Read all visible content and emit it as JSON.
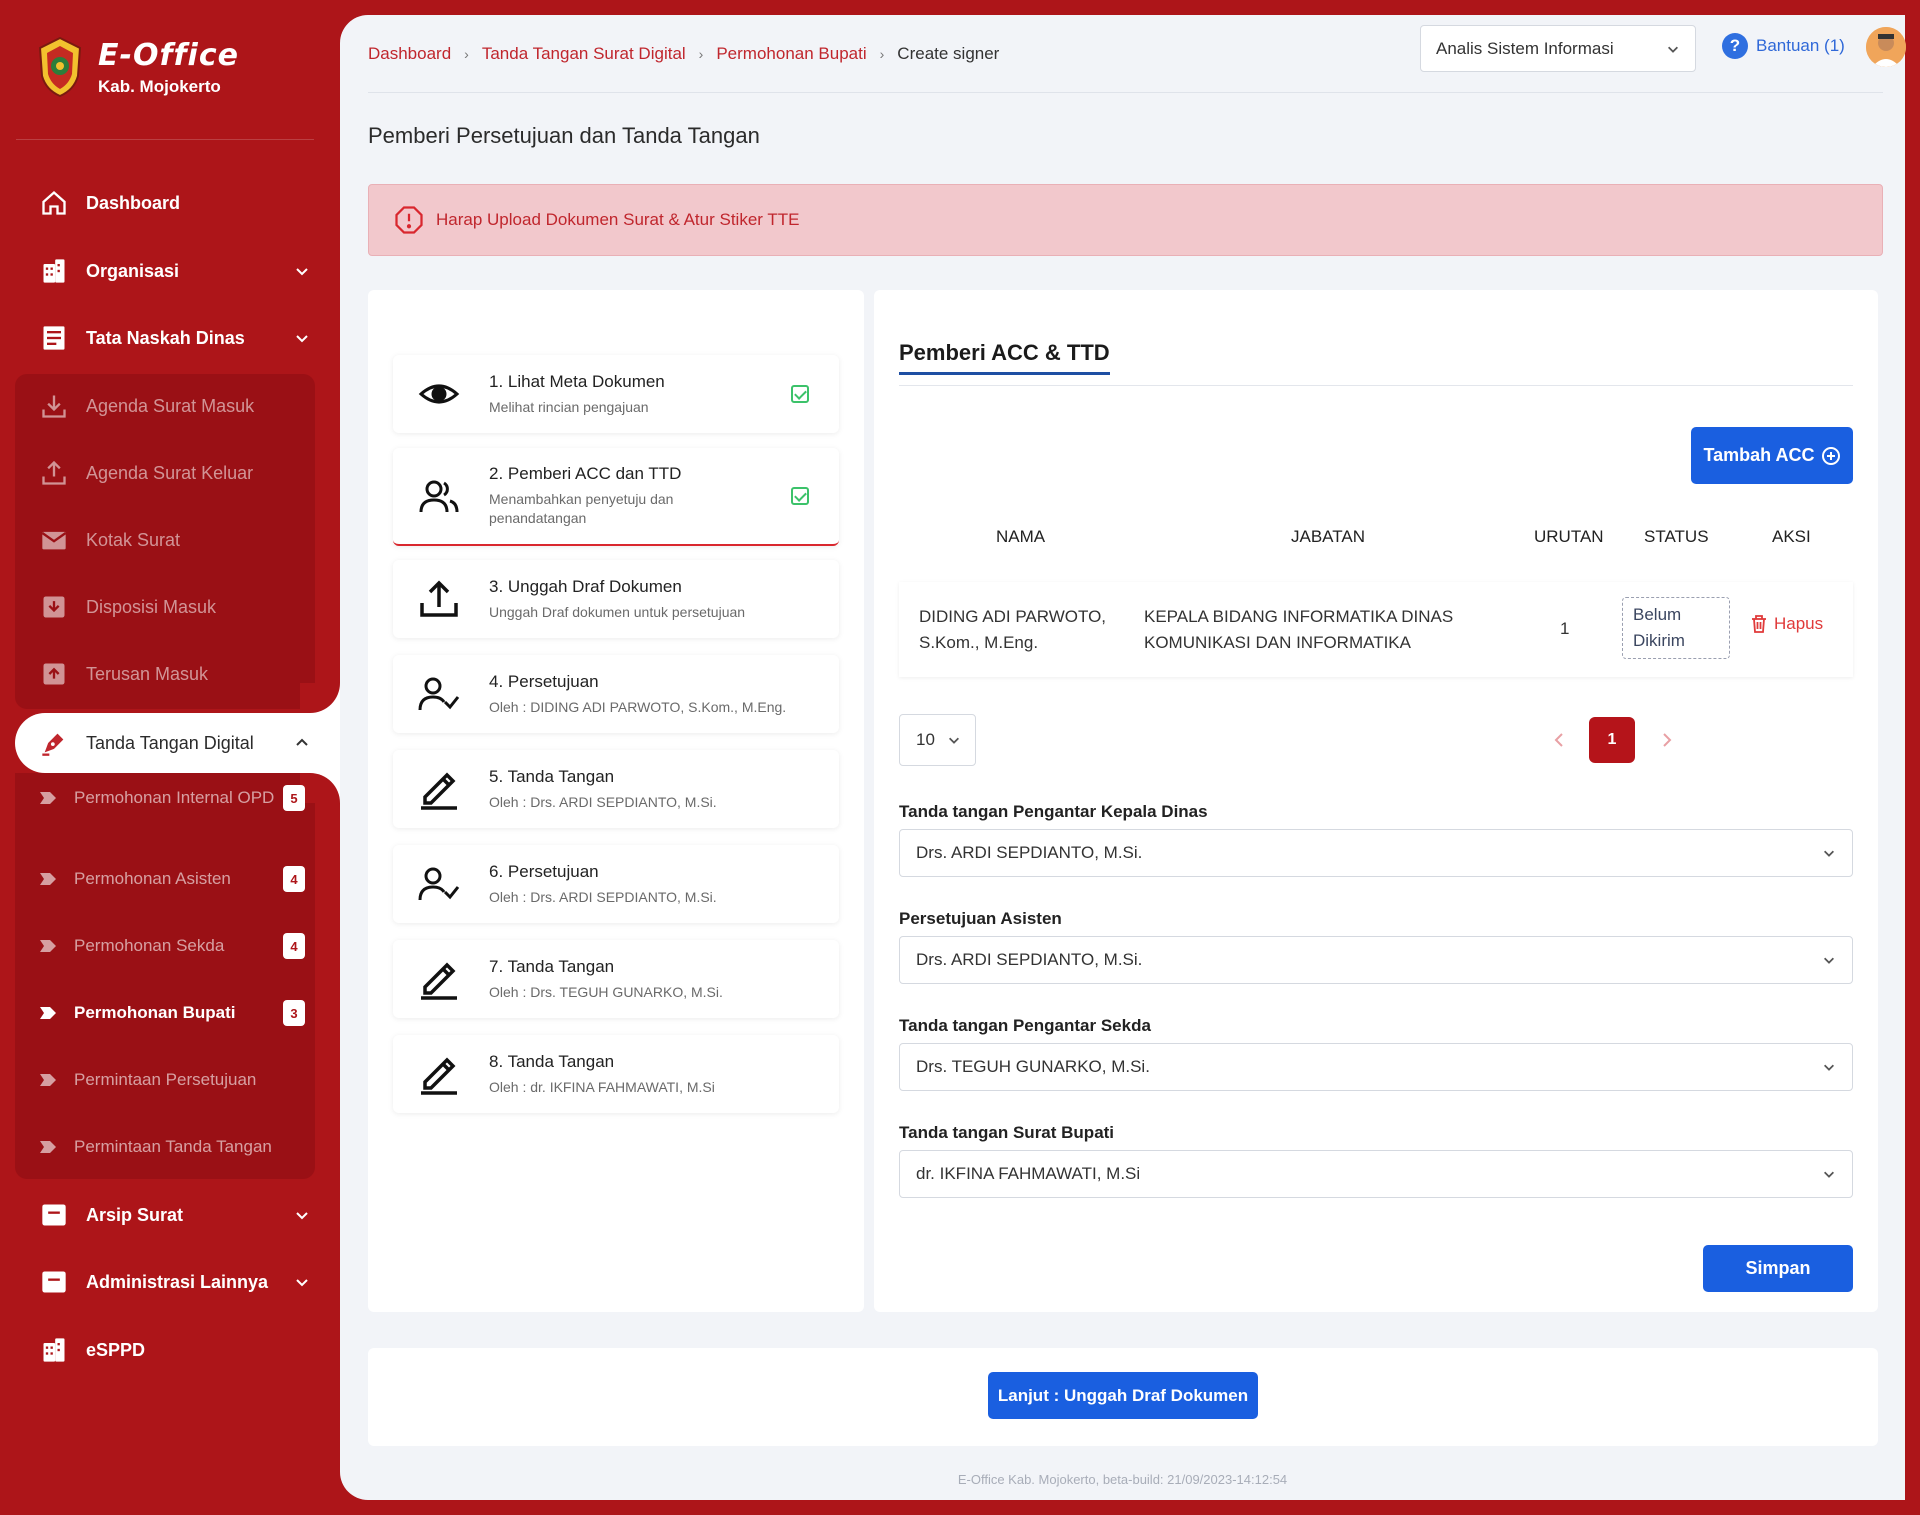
{
  "app": {
    "name": "E-Office",
    "org": "Kab. Mojokerto"
  },
  "sidebar": {
    "items": [
      {
        "label": "Dashboard",
        "icon": "home-icon"
      },
      {
        "label": "Organisasi",
        "icon": "building-icon"
      },
      {
        "label": "Tata Naskah Dinas",
        "icon": "document-icon"
      }
    ],
    "naskah_sub": [
      {
        "label": "Agenda Surat Masuk",
        "icon": "inbox-download-icon"
      },
      {
        "label": "Agenda Surat Keluar",
        "icon": "outbox-upload-icon"
      },
      {
        "label": "Kotak Surat",
        "icon": "mail-icon"
      },
      {
        "label": "Disposisi Masuk",
        "icon": "archive-in-icon"
      },
      {
        "label": "Terusan Masuk",
        "icon": "archive-forward-icon"
      }
    ],
    "active": {
      "label": "Tanda Tangan Digital",
      "icon": "pen-nib-icon"
    },
    "ttd_sub": [
      {
        "label": "Permohonan Internal OPD",
        "badge": "5"
      },
      {
        "label": "Permohonan Asisten",
        "badge": "4"
      },
      {
        "label": "Permohonan Sekda",
        "badge": "4"
      },
      {
        "label": "Permohonan Bupati",
        "badge": "3"
      },
      {
        "label": "Permintaan Persetujuan",
        "badge": ""
      },
      {
        "label": "Permintaan Tanda Tangan",
        "badge": ""
      }
    ],
    "bottom": [
      {
        "label": "Arsip Surat",
        "icon": "archive-box-icon"
      },
      {
        "label": "Administrasi Lainnya",
        "icon": "archive-box-icon"
      },
      {
        "label": "eSPPD",
        "icon": "building-icon"
      }
    ]
  },
  "header": {
    "breadcrumb": [
      "Dashboard",
      "Tanda Tangan Surat Digital",
      "Permohonan Bupati",
      "Create signer"
    ],
    "role": "Analis Sistem Informasi",
    "help": "Bantuan (1)"
  },
  "page": {
    "title": "Pemberi Persetujuan dan Tanda Tangan",
    "alert": "Harap Upload Dokumen Surat & Atur Stiker TTE"
  },
  "steps": [
    {
      "title": "1. Lihat Meta Dokumen",
      "sub": "Melihat rincian pengajuan",
      "done": true,
      "icon": "eye-icon"
    },
    {
      "title": "2. Pemberi ACC dan TTD",
      "sub": "Menambahkan penyetuju dan penandatangan",
      "done": true,
      "icon": "users-icon"
    },
    {
      "title": "3. Unggah Draf Dokumen",
      "sub": "Unggah Draf dokumen untuk persetujuan",
      "done": false,
      "icon": "upload-icon"
    },
    {
      "title": "4. Persetujuan",
      "sub": "Oleh : DIDING ADI PARWOTO, S.Kom., M.Eng.",
      "done": false,
      "icon": "user-check-icon"
    },
    {
      "title": "5. Tanda Tangan",
      "sub": "Oleh : Drs. ARDI SEPDIANTO, M.Si.",
      "done": false,
      "icon": "pen-sign-icon"
    },
    {
      "title": "6. Persetujuan",
      "sub": "Oleh : Drs. ARDI SEPDIANTO, M.Si.",
      "done": false,
      "icon": "user-check-icon"
    },
    {
      "title": "7. Tanda Tangan",
      "sub": "Oleh : Drs. TEGUH GUNARKO, M.Si.",
      "done": false,
      "icon": "pen-sign-icon"
    },
    {
      "title": "8. Tanda Tangan",
      "sub": "Oleh : dr. IKFINA FAHMAWATI, M.Si",
      "done": false,
      "icon": "pen-sign-icon"
    }
  ],
  "acc": {
    "tab": "Pemberi ACC & TTD",
    "add_button": "Tambah ACC",
    "columns": [
      "NAMA",
      "JABATAN",
      "URUTAN",
      "STATUS",
      "AKSI"
    ],
    "rows": [
      {
        "nama_1": "DIDING ADI PARWOTO,",
        "nama_2": "S.Kom., M.Eng.",
        "jabatan_1": "KEPALA BIDANG INFORMATIKA DINAS",
        "jabatan_2": "KOMUNIKASI DAN INFORMATIKA",
        "urutan": "1",
        "status_1": "Belum",
        "status_2": "Dikirim",
        "aksi": "Hapus"
      }
    ],
    "page_size": "10",
    "current_page": "1",
    "fields": [
      {
        "label": "Tanda tangan Pengantar Kepala Dinas",
        "value": "Drs. ARDI SEPDIANTO, M.Si."
      },
      {
        "label": "Persetujuan Asisten",
        "value": "Drs. ARDI SEPDIANTO, M.Si."
      },
      {
        "label": "Tanda tangan Pengantar Sekda",
        "value": "Drs. TEGUH GUNARKO, M.Si."
      },
      {
        "label": "Tanda tangan Surat Bupati",
        "value": "dr. IKFINA FAHMAWATI, M.Si"
      }
    ],
    "save_button": "Simpan"
  },
  "next_button": "Lanjut : Unggah Draf Dokumen",
  "footer": "E-Office Kab. Mojokerto, beta-build: 21/09/2023-14:12:54",
  "colors": {
    "brand": "#ad1519",
    "primary": "#1a5fe0",
    "success": "#3cc26a",
    "danger": "#e03a3a"
  }
}
